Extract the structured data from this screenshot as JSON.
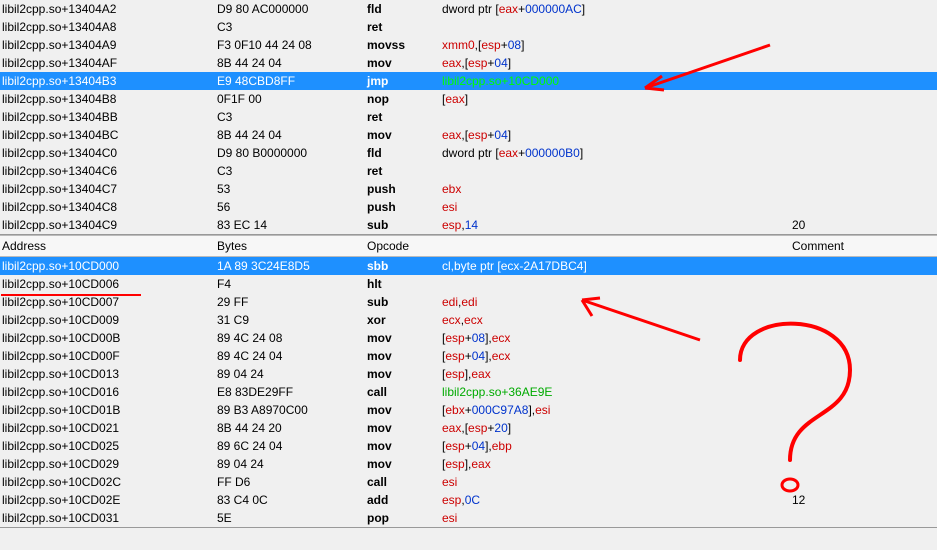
{
  "top_pane": {
    "rows": [
      {
        "addr": "libil2cpp.so+13404A2",
        "bytes": "D9 80 AC000000",
        "op": "fld",
        "ops": [
          {
            "t": "pun",
            "v": "dword ptr ["
          },
          {
            "t": "reg",
            "v": "eax"
          },
          {
            "t": "pun",
            "v": "+"
          },
          {
            "t": "num",
            "v": "000000AC"
          },
          {
            "t": "pun",
            "v": "]"
          }
        ],
        "sel": false,
        "cmt": ""
      },
      {
        "addr": "libil2cpp.so+13404A8",
        "bytes": "C3",
        "op": "ret",
        "ops": [],
        "sel": false,
        "cmt": ""
      },
      {
        "addr": "libil2cpp.so+13404A9",
        "bytes": "F3 0F10 44 24 08",
        "op": "movss",
        "ops": [
          {
            "t": "reg",
            "v": "xmm0"
          },
          {
            "t": "pun",
            "v": ",["
          },
          {
            "t": "reg",
            "v": "esp"
          },
          {
            "t": "pun",
            "v": "+"
          },
          {
            "t": "num",
            "v": "08"
          },
          {
            "t": "pun",
            "v": "]"
          }
        ],
        "sel": false,
        "cmt": ""
      },
      {
        "addr": "libil2cpp.so+13404AF",
        "bytes": "8B 44 24 04",
        "op": "mov",
        "ops": [
          {
            "t": "reg",
            "v": "eax"
          },
          {
            "t": "pun",
            "v": ",["
          },
          {
            "t": "reg",
            "v": "esp"
          },
          {
            "t": "pun",
            "v": "+"
          },
          {
            "t": "num",
            "v": "04"
          },
          {
            "t": "pun",
            "v": "]"
          }
        ],
        "sel": false,
        "cmt": ""
      },
      {
        "addr": "libil2cpp.so+13404B3",
        "bytes": "E9 48CBD8FF",
        "op": "jmp",
        "ops": [
          {
            "t": "sym",
            "v": "libil2cpp.so+10CD000"
          }
        ],
        "sel": true,
        "cmt": ""
      },
      {
        "addr": "libil2cpp.so+13404B8",
        "bytes": "0F1F 00",
        "op": "nop",
        "ops": [
          {
            "t": "pun",
            "v": "["
          },
          {
            "t": "reg",
            "v": "eax"
          },
          {
            "t": "pun",
            "v": "]"
          }
        ],
        "sel": false,
        "cmt": ""
      },
      {
        "addr": "libil2cpp.so+13404BB",
        "bytes": "C3",
        "op": "ret",
        "ops": [],
        "sel": false,
        "cmt": ""
      },
      {
        "addr": "libil2cpp.so+13404BC",
        "bytes": "8B 44 24 04",
        "op": "mov",
        "ops": [
          {
            "t": "reg",
            "v": "eax"
          },
          {
            "t": "pun",
            "v": ",["
          },
          {
            "t": "reg",
            "v": "esp"
          },
          {
            "t": "pun",
            "v": "+"
          },
          {
            "t": "num",
            "v": "04"
          },
          {
            "t": "pun",
            "v": "]"
          }
        ],
        "sel": false,
        "cmt": ""
      },
      {
        "addr": "libil2cpp.so+13404C0",
        "bytes": "D9 80 B0000000",
        "op": "fld",
        "ops": [
          {
            "t": "pun",
            "v": "dword ptr ["
          },
          {
            "t": "reg",
            "v": "eax"
          },
          {
            "t": "pun",
            "v": "+"
          },
          {
            "t": "num",
            "v": "000000B0"
          },
          {
            "t": "pun",
            "v": "]"
          }
        ],
        "sel": false,
        "cmt": ""
      },
      {
        "addr": "libil2cpp.so+13404C6",
        "bytes": "C3",
        "op": "ret",
        "ops": [],
        "sel": false,
        "cmt": ""
      },
      {
        "addr": "libil2cpp.so+13404C7",
        "bytes": "53",
        "op": "push",
        "ops": [
          {
            "t": "reg",
            "v": "ebx"
          }
        ],
        "sel": false,
        "cmt": ""
      },
      {
        "addr": "libil2cpp.so+13404C8",
        "bytes": "56",
        "op": "push",
        "ops": [
          {
            "t": "reg",
            "v": "esi"
          }
        ],
        "sel": false,
        "cmt": ""
      },
      {
        "addr": "libil2cpp.so+13404C9",
        "bytes": "83 EC 14",
        "op": "sub",
        "ops": [
          {
            "t": "reg",
            "v": "esp"
          },
          {
            "t": "pun",
            "v": ","
          },
          {
            "t": "num",
            "v": "14"
          }
        ],
        "sel": false,
        "cmt": "20"
      }
    ]
  },
  "bottom_header": {
    "addr": "Address",
    "bytes": "Bytes",
    "op": "Opcode",
    "cmt": "Comment"
  },
  "bottom_pane": {
    "rows": [
      {
        "addr": "libil2cpp.so+10CD000",
        "bytes": "1A 89 3C24E8D5",
        "op": "sbb",
        "ops": [
          {
            "t": "reg",
            "v": "cl"
          },
          {
            "t": "pun",
            "v": ",byte ptr ["
          },
          {
            "t": "reg",
            "v": "ecx"
          },
          {
            "t": "pun",
            "v": "-"
          },
          {
            "t": "num",
            "v": "2A17DBC4"
          },
          {
            "t": "pun",
            "v": "]"
          }
        ],
        "sel": true,
        "cmt": ""
      },
      {
        "addr": "libil2cpp.so+10CD006",
        "bytes": "F4",
        "op": "hlt",
        "ops": [],
        "sel": false,
        "cmt": ""
      },
      {
        "addr": "libil2cpp.so+10CD007",
        "bytes": "29 FF",
        "op": "sub",
        "ops": [
          {
            "t": "reg",
            "v": "edi"
          },
          {
            "t": "pun",
            "v": ","
          },
          {
            "t": "reg",
            "v": "edi"
          }
        ],
        "sel": false,
        "cmt": ""
      },
      {
        "addr": "libil2cpp.so+10CD009",
        "bytes": "31 C9",
        "op": "xor",
        "ops": [
          {
            "t": "reg",
            "v": "ecx"
          },
          {
            "t": "pun",
            "v": ","
          },
          {
            "t": "reg",
            "v": "ecx"
          }
        ],
        "sel": false,
        "cmt": ""
      },
      {
        "addr": "libil2cpp.so+10CD00B",
        "bytes": "89 4C 24 08",
        "op": "mov",
        "ops": [
          {
            "t": "pun",
            "v": "["
          },
          {
            "t": "reg",
            "v": "esp"
          },
          {
            "t": "pun",
            "v": "+"
          },
          {
            "t": "num",
            "v": "08"
          },
          {
            "t": "pun",
            "v": "],"
          },
          {
            "t": "reg",
            "v": "ecx"
          }
        ],
        "sel": false,
        "cmt": ""
      },
      {
        "addr": "libil2cpp.so+10CD00F",
        "bytes": "89 4C 24 04",
        "op": "mov",
        "ops": [
          {
            "t": "pun",
            "v": "["
          },
          {
            "t": "reg",
            "v": "esp"
          },
          {
            "t": "pun",
            "v": "+"
          },
          {
            "t": "num",
            "v": "04"
          },
          {
            "t": "pun",
            "v": "],"
          },
          {
            "t": "reg",
            "v": "ecx"
          }
        ],
        "sel": false,
        "cmt": ""
      },
      {
        "addr": "libil2cpp.so+10CD013",
        "bytes": "89 04 24",
        "op": "mov",
        "ops": [
          {
            "t": "pun",
            "v": "["
          },
          {
            "t": "reg",
            "v": "esp"
          },
          {
            "t": "pun",
            "v": "],"
          },
          {
            "t": "reg",
            "v": "eax"
          }
        ],
        "sel": false,
        "cmt": ""
      },
      {
        "addr": "libil2cpp.so+10CD016",
        "bytes": "E8 83DE29FF",
        "op": "call",
        "ops": [
          {
            "t": "sym",
            "v": "libil2cpp.so+36AE9E"
          }
        ],
        "sel": false,
        "cmt": ""
      },
      {
        "addr": "libil2cpp.so+10CD01B",
        "bytes": "89 B3 A8970C00",
        "op": "mov",
        "ops": [
          {
            "t": "pun",
            "v": "["
          },
          {
            "t": "reg",
            "v": "ebx"
          },
          {
            "t": "pun",
            "v": "+"
          },
          {
            "t": "num",
            "v": "000C97A8"
          },
          {
            "t": "pun",
            "v": "],"
          },
          {
            "t": "reg",
            "v": "esi"
          }
        ],
        "sel": false,
        "cmt": ""
      },
      {
        "addr": "libil2cpp.so+10CD021",
        "bytes": "8B 44 24 20",
        "op": "mov",
        "ops": [
          {
            "t": "reg",
            "v": "eax"
          },
          {
            "t": "pun",
            "v": ",["
          },
          {
            "t": "reg",
            "v": "esp"
          },
          {
            "t": "pun",
            "v": "+"
          },
          {
            "t": "num",
            "v": "20"
          },
          {
            "t": "pun",
            "v": "]"
          }
        ],
        "sel": false,
        "cmt": ""
      },
      {
        "addr": "libil2cpp.so+10CD025",
        "bytes": "89 6C 24 04",
        "op": "mov",
        "ops": [
          {
            "t": "pun",
            "v": "["
          },
          {
            "t": "reg",
            "v": "esp"
          },
          {
            "t": "pun",
            "v": "+"
          },
          {
            "t": "num",
            "v": "04"
          },
          {
            "t": "pun",
            "v": "],"
          },
          {
            "t": "reg",
            "v": "ebp"
          }
        ],
        "sel": false,
        "cmt": ""
      },
      {
        "addr": "libil2cpp.so+10CD029",
        "bytes": "89 04 24",
        "op": "mov",
        "ops": [
          {
            "t": "pun",
            "v": "["
          },
          {
            "t": "reg",
            "v": "esp"
          },
          {
            "t": "pun",
            "v": "],"
          },
          {
            "t": "reg",
            "v": "eax"
          }
        ],
        "sel": false,
        "cmt": ""
      },
      {
        "addr": "libil2cpp.so+10CD02C",
        "bytes": "FF D6",
        "op": "call",
        "ops": [
          {
            "t": "reg",
            "v": "esi"
          }
        ],
        "sel": false,
        "cmt": ""
      },
      {
        "addr": "libil2cpp.so+10CD02E",
        "bytes": "83 C4 0C",
        "op": "add",
        "ops": [
          {
            "t": "reg",
            "v": "esp"
          },
          {
            "t": "pun",
            "v": ","
          },
          {
            "t": "num",
            "v": "0C"
          }
        ],
        "sel": false,
        "cmt": "12"
      },
      {
        "addr": "libil2cpp.so+10CD031",
        "bytes": "5E",
        "op": "pop",
        "ops": [
          {
            "t": "reg",
            "v": "esi"
          }
        ],
        "sel": false,
        "cmt": ""
      }
    ]
  }
}
